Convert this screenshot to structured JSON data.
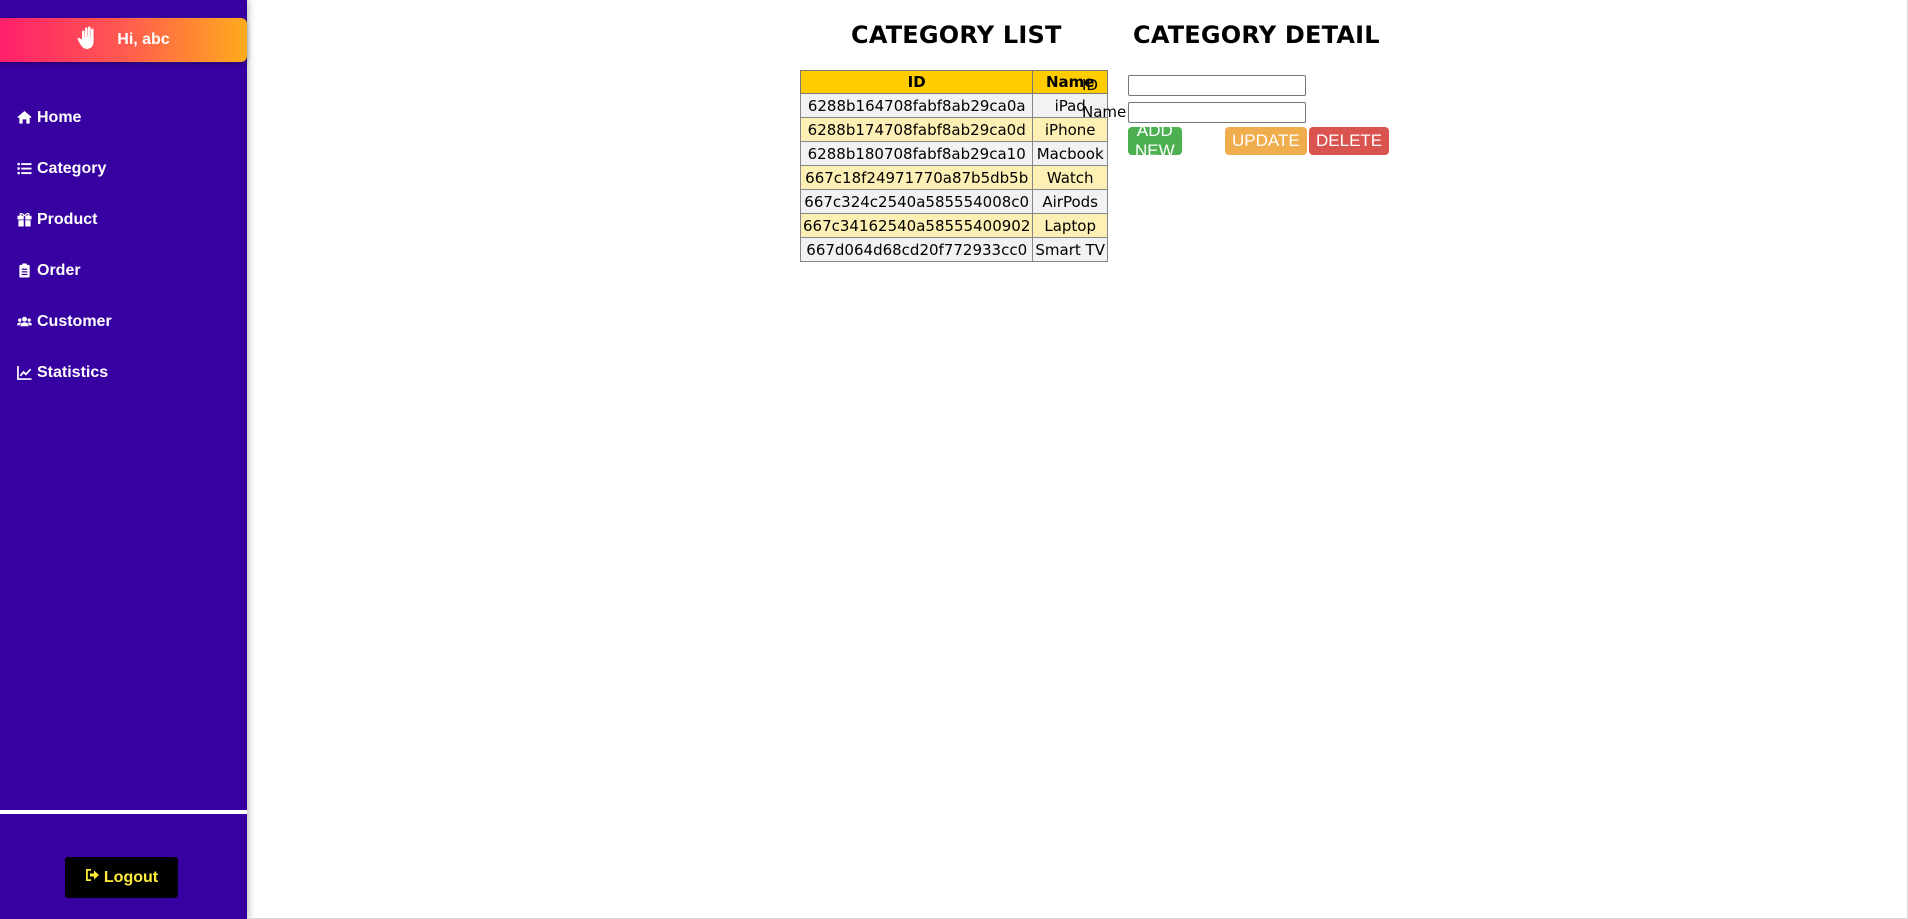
{
  "sidebar": {
    "greeting": "Hi, abc",
    "items": [
      {
        "label": "Home",
        "icon": "home-icon"
      },
      {
        "label": "Category",
        "icon": "list-icon"
      },
      {
        "label": "Product",
        "icon": "gift-icon"
      },
      {
        "label": "Order",
        "icon": "clipboard-icon"
      },
      {
        "label": "Customer",
        "icon": "users-icon"
      },
      {
        "label": "Statistics",
        "icon": "chart-line-icon"
      }
    ],
    "logout_label": "Logout"
  },
  "colors": {
    "sidebar_bg": "#3701a1",
    "table_header": "#ffcc00",
    "add_button": "#4caf50",
    "update_button": "#efad4d",
    "delete_button": "#d9534f"
  },
  "category_list": {
    "title": "CATEGORY LIST",
    "columns": [
      "ID",
      "Name"
    ],
    "rows": [
      [
        "6288b164708fabf8ab29ca0a",
        "iPad"
      ],
      [
        "6288b174708fabf8ab29ca0d",
        "iPhone"
      ],
      [
        "6288b180708fabf8ab29ca10",
        "Macbook"
      ],
      [
        "667c18f24971770a87b5db5b",
        "Watch"
      ],
      [
        "667c324c2540a585554008c0",
        "AirPods"
      ],
      [
        "667c34162540a58555400902",
        "Laptop"
      ],
      [
        "667d064d68cd20f772933cc0",
        "Smart TV"
      ]
    ]
  },
  "category_detail": {
    "title": "CATEGORY DETAIL",
    "id_label": "ID",
    "id_value": "",
    "name_label": "Name",
    "name_value": "",
    "add_label": "ADD NEW",
    "update_label": "UPDATE",
    "delete_label": "DELETE"
  }
}
